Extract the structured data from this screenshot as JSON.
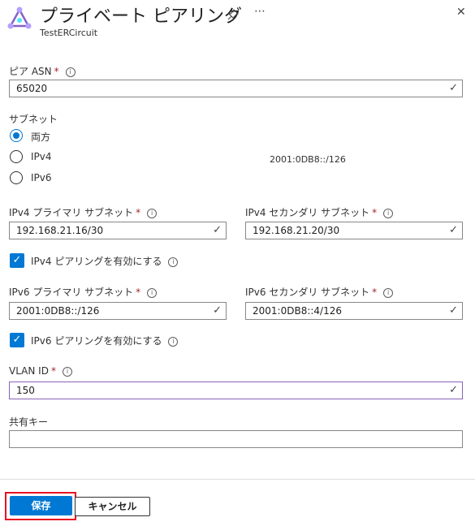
{
  "header": {
    "title": "プライベート ピアリング",
    "subtitle": "TestERCircuit",
    "pin_icon": "pin-icon",
    "more_label": "⋯",
    "close_label": "✕"
  },
  "peer_asn": {
    "label": "ピア ASN",
    "value": "65020"
  },
  "subnet": {
    "label": "サブネット",
    "options": [
      "両方",
      "IPv4",
      "IPv6"
    ],
    "selected": "両方",
    "side_text": "2001:0DB8::/126"
  },
  "ipv4": {
    "primary_label": "IPv4 プライマリ サブネット",
    "primary_value": "192.168.21.16/30",
    "secondary_label": "IPv4 セカンダリ サブネット",
    "secondary_value": "192.168.21.20/30",
    "enable_label": "IPv4 ピアリングを有効にする",
    "enabled": true
  },
  "ipv6": {
    "primary_label": "IPv6 プライマリ サブネット",
    "primary_value": "2001:0DB8::/126",
    "secondary_label": "IPv6 セカンダリ サブネット",
    "secondary_value": "2001:0DB8::4/126",
    "enable_label": "IPv6 ピアリングを有効にする",
    "enabled": true
  },
  "vlan": {
    "label": "VLAN ID",
    "value": "150"
  },
  "shared_key": {
    "label": "共有キー",
    "value": ""
  },
  "footer": {
    "save_label": "保存",
    "cancel_label": "キャンセル"
  },
  "colors": {
    "accent": "#0078d4",
    "required": "#a4262c",
    "highlight": "#e81123"
  }
}
